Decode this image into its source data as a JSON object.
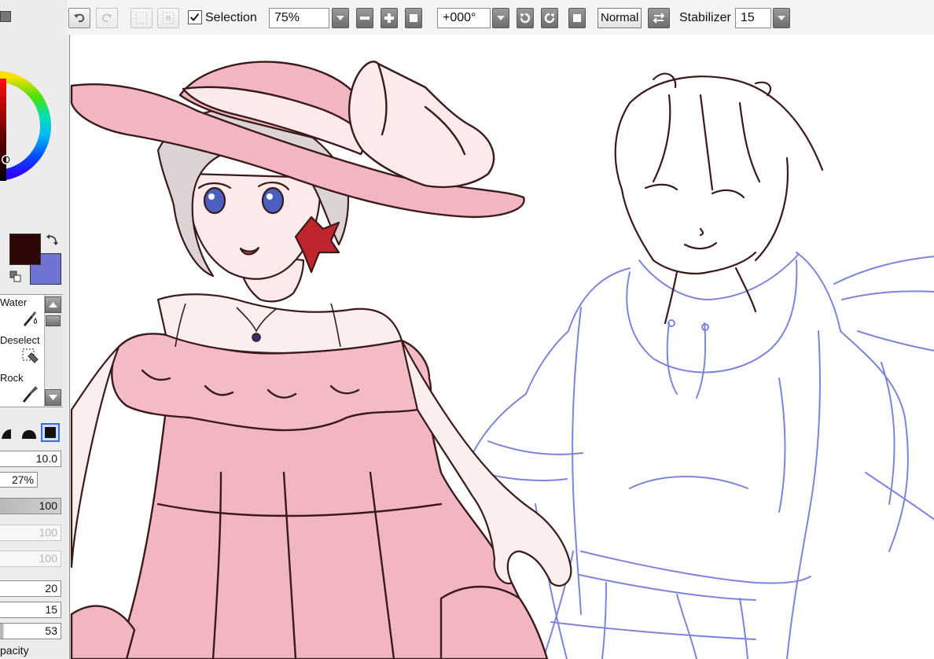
{
  "toolbar": {
    "selection_label": "Selection",
    "selection_checked": true,
    "zoom_value": "75%",
    "rotation_value": "+000°",
    "view_mode_label": "Normal",
    "stabilizer_label": "Stabilizer",
    "stabilizer_value": "15"
  },
  "colors": {
    "primary": "#2e0606",
    "secondary": "#6f74d4",
    "sketch_blue": "#6f77d8",
    "dress_pink": "#f2b6c0",
    "lineart": "#3a1a1a"
  },
  "tools": [
    {
      "name": "Water",
      "icon": "water-brush-icon"
    },
    {
      "name": "Deselect",
      "icon": "deselect-icon"
    },
    {
      "name": "Rock",
      "icon": "rock-brush-icon"
    }
  ],
  "brush": {
    "size": "10.0",
    "min_size": "27%",
    "density": "100",
    "blending": "100",
    "dilution": "100",
    "persistence": "20",
    "hardness": "15",
    "strength": "53",
    "opacity_label": "pacity"
  }
}
